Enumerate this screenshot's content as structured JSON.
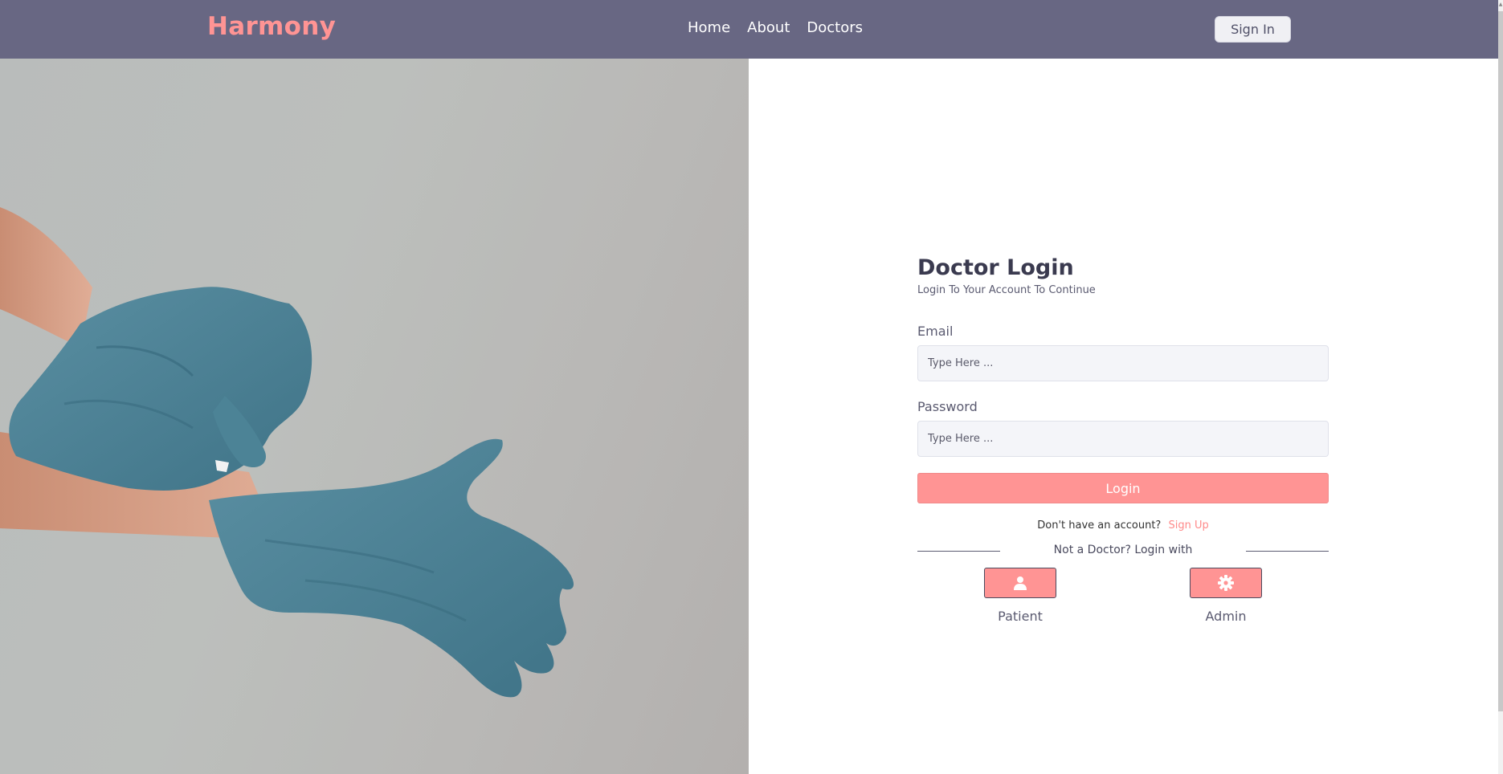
{
  "navbar": {
    "brand": "Harmony",
    "links": [
      "Home",
      "About",
      "Doctors"
    ],
    "signin_label": "Sign In"
  },
  "login": {
    "title": "Doctor Login",
    "subtitle": "Login To Your Account To Continue",
    "email_label": "Email",
    "email_placeholder": "Type Here ...",
    "password_label": "Password",
    "password_placeholder": "Type Here ...",
    "button_label": "Login",
    "no_account_text": "Don't have an account?",
    "signup_label": "Sign Up",
    "divider_text": "Not a Doctor? Login with",
    "alternatives": [
      {
        "label": "Patient",
        "icon": "user-icon"
      },
      {
        "label": "Admin",
        "icon": "gear-icon"
      }
    ]
  },
  "colors": {
    "navbar_bg": "#686783",
    "brand": "#ff9494",
    "accent": "#ff9494",
    "glove": "#4d8093",
    "skin": "#d9a38a"
  }
}
